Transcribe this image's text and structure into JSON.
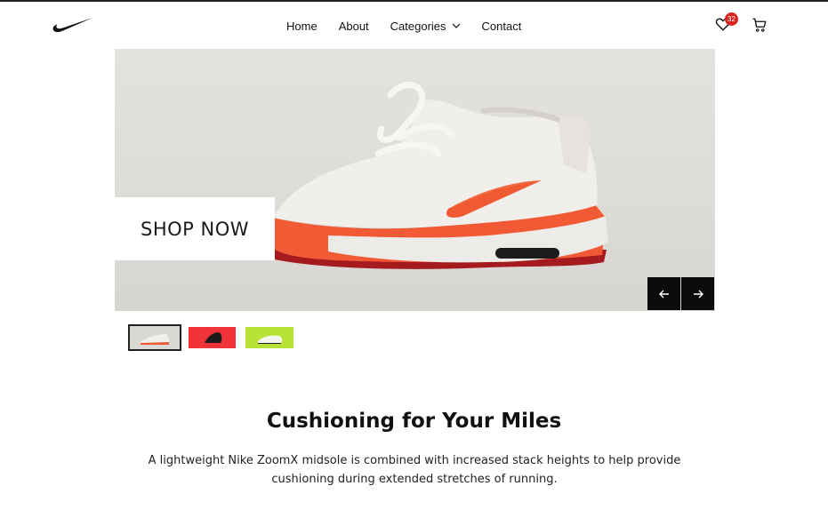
{
  "nav": {
    "home": "Home",
    "about": "About",
    "categories": "Categories",
    "contact": "Contact"
  },
  "header": {
    "favorites_count": "32",
    "logo_icon": "nike-swoosh-icon",
    "favorites_icon": "heart-icon",
    "cart_icon": "cart-icon"
  },
  "hero": {
    "cta": "SHOP NOW",
    "prev_icon": "arrow-left-icon",
    "next_icon": "arrow-right-icon",
    "thumbnails": [
      {
        "color": "#d9d8d5",
        "active": true
      },
      {
        "color": "#ef3338",
        "active": false
      },
      {
        "color": "#b9e236",
        "active": false
      }
    ]
  },
  "content": {
    "headline": "Cushioning for Your Miles",
    "description": "A lightweight Nike ZoomX midsole is combined with increased stack heights to help provide cushioning during extended stretches of running."
  },
  "colors": {
    "accent_orange": "#f25a36",
    "badge_red": "#d6241f",
    "dark": "#0b0b0b"
  }
}
